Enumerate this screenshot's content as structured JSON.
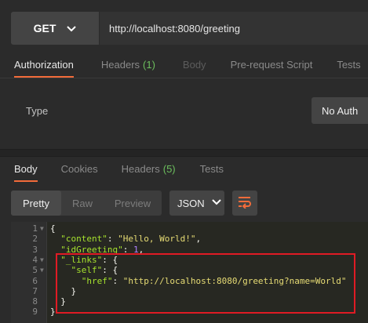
{
  "request": {
    "method": "GET",
    "url": "http://localhost:8080/greeting"
  },
  "request_tabs": [
    {
      "label": "Authorization",
      "active": true,
      "disabled": false,
      "count": ""
    },
    {
      "label": "Headers",
      "active": false,
      "disabled": false,
      "count": "(1)"
    },
    {
      "label": "Body",
      "active": false,
      "disabled": true,
      "count": ""
    },
    {
      "label": "Pre-request Script",
      "active": false,
      "disabled": false,
      "count": ""
    },
    {
      "label": "Tests",
      "active": false,
      "disabled": false,
      "count": ""
    }
  ],
  "auth": {
    "type_label": "Type",
    "type_value": "No Auth"
  },
  "response_tabs": [
    {
      "label": "Body",
      "active": true,
      "count": ""
    },
    {
      "label": "Cookies",
      "active": false,
      "count": ""
    },
    {
      "label": "Headers",
      "active": false,
      "count": "(5)"
    },
    {
      "label": "Tests",
      "active": false,
      "count": ""
    }
  ],
  "response_view": {
    "modes": [
      "Pretty",
      "Raw",
      "Preview"
    ],
    "active_mode": "Pretty",
    "format": "JSON"
  },
  "colors": {
    "accent": "#f26b3a",
    "count_green": "#6cbf5d",
    "highlight_red": "#e01b24"
  },
  "code_lines": [
    {
      "n": "1",
      "fold": true,
      "parts": [
        [
          "p",
          "{"
        ]
      ]
    },
    {
      "n": "2",
      "fold": false,
      "parts": [
        [
          "p",
          "  "
        ],
        [
          "k",
          "\"content\""
        ],
        [
          "p",
          ": "
        ],
        [
          "s",
          "\"Hello, World!\""
        ],
        [
          "p",
          ","
        ]
      ]
    },
    {
      "n": "3",
      "fold": false,
      "parts": [
        [
          "p",
          "  "
        ],
        [
          "k",
          "\"idGreeting\""
        ],
        [
          "p",
          ": "
        ],
        [
          "n",
          "1"
        ],
        [
          "p",
          ","
        ]
      ]
    },
    {
      "n": "4",
      "fold": true,
      "parts": [
        [
          "p",
          "  "
        ],
        [
          "k",
          "\"_links\""
        ],
        [
          "p",
          ": {"
        ]
      ]
    },
    {
      "n": "5",
      "fold": true,
      "parts": [
        [
          "p",
          "    "
        ],
        [
          "k",
          "\"self\""
        ],
        [
          "p",
          ": {"
        ]
      ]
    },
    {
      "n": "6",
      "fold": false,
      "parts": [
        [
          "p",
          "      "
        ],
        [
          "k",
          "\"href\""
        ],
        [
          "p",
          ": "
        ],
        [
          "s",
          "\"http://localhost:8080/greeting?name=World\""
        ]
      ]
    },
    {
      "n": "7",
      "fold": false,
      "parts": [
        [
          "p",
          "    }"
        ]
      ]
    },
    {
      "n": "8",
      "fold": false,
      "parts": [
        [
          "p",
          "  }"
        ]
      ]
    },
    {
      "n": "9",
      "fold": false,
      "parts": [
        [
          "p",
          "}"
        ]
      ]
    }
  ]
}
